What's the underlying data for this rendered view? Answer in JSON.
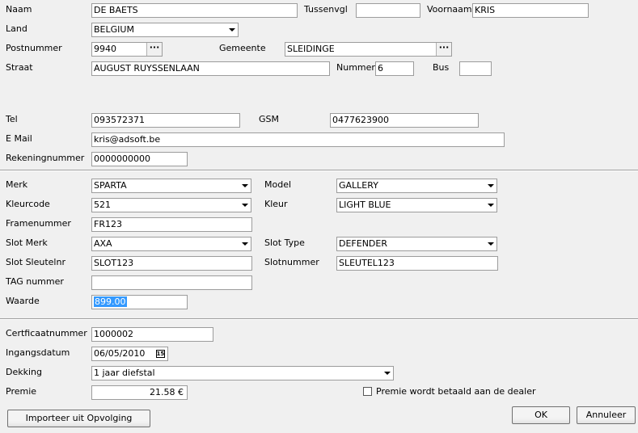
{
  "personal": {
    "naam_label": "Naam",
    "naam": "DE BAETS",
    "tussenvgl_label": "Tussenvgl",
    "tussenvgl": "",
    "voornaam_label": "Voornaam",
    "voornaam": "KRIS",
    "land_label": "Land",
    "land": "BELGIUM",
    "postnummer_label": "Postnummer",
    "postnummer": "9940",
    "gemeente_label": "Gemeente",
    "gemeente": "SLEIDINGE",
    "straat_label": "Straat",
    "straat": "AUGUST RUYSSENLAAN",
    "nummer_label": "Nummer",
    "nummer": "6",
    "bus_label": "Bus",
    "bus": "",
    "tel_label": "Tel",
    "tel": "093572371",
    "gsm_label": "GSM",
    "gsm": "0477623900",
    "email_label": "E Mail",
    "email": "kris@adsoft.be",
    "rekening_label": "Rekeningnummer",
    "rekening": "0000000000"
  },
  "bike": {
    "merk_label": "Merk",
    "merk": "SPARTA",
    "model_label": "Model",
    "model": "GALLERY",
    "kleurcode_label": "Kleurcode",
    "kleurcode": "521",
    "kleur_label": "Kleur",
    "kleur": "LIGHT BLUE",
    "framenummer_label": "Framenummer",
    "framenummer": "FR123",
    "slotmerk_label": "Slot Merk",
    "slotmerk": "AXA",
    "slottype_label": "Slot Type",
    "slottype": "DEFENDER",
    "slotsleutel_label": "Slot Sleutelnr",
    "slotsleutel": "SLOT123",
    "slotnummer_label": "Slotnummer",
    "slotnummer": "SLEUTEL123",
    "tag_label": "TAG nummer",
    "tag": "",
    "waarde_label": "Waarde",
    "waarde": "899.00"
  },
  "policy": {
    "certificaat_label": "Certficaatnummer",
    "certificaat": "1000002",
    "ingang_label": "Ingangsdatum",
    "ingang": "06/05/2010",
    "cal_glyph": "15",
    "dekking_label": "Dekking",
    "dekking": "1 jaar diefstal",
    "premie_label": "Premie",
    "premie": "21.58 €",
    "dealer_checkbox_label": "Premie wordt betaald aan de dealer"
  },
  "buttons": {
    "import": "Importeer uit Opvolging",
    "ok": "OK",
    "annuleer": "Annuleer"
  },
  "icons": {
    "combo": "chevron-down-icon",
    "browse": "ellipsis-icon",
    "calendar": "calendar-icon"
  }
}
